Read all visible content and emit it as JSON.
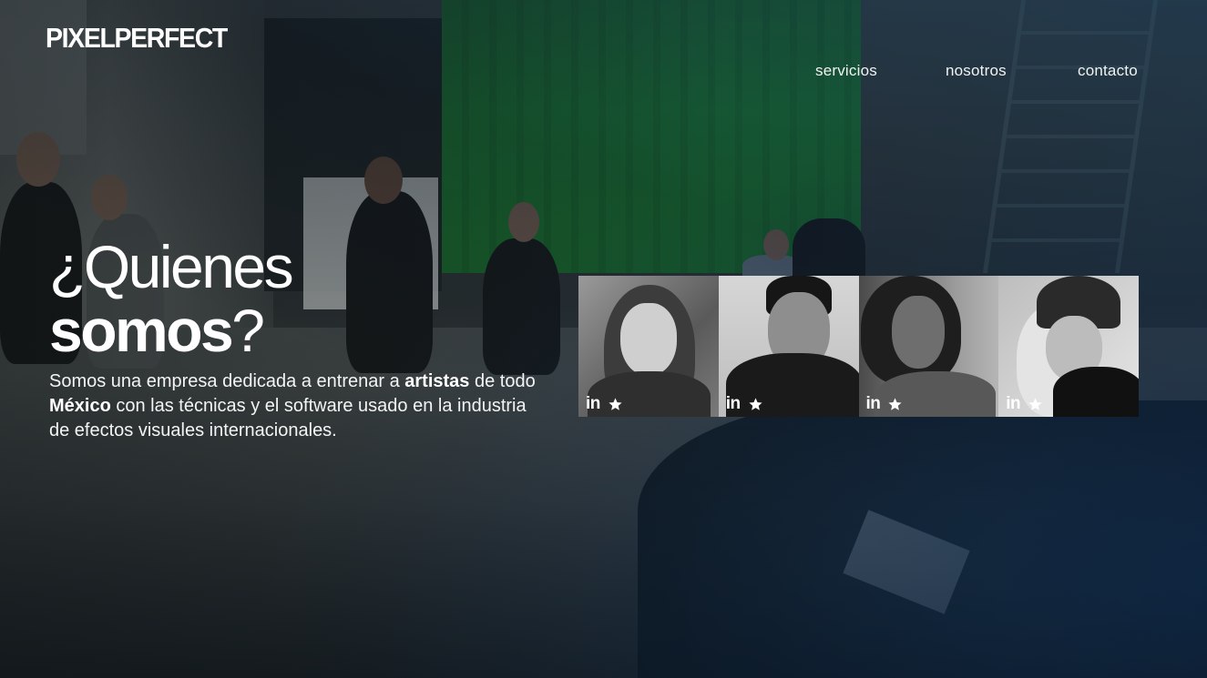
{
  "brand": {
    "logo_text": "PIXELPERFECT"
  },
  "nav": {
    "items": [
      {
        "label": "servicios"
      },
      {
        "label": "nosotros"
      },
      {
        "label": "contacto"
      }
    ]
  },
  "hero": {
    "heading_line1": "¿Quienes",
    "heading_bold": "somos",
    "heading_end": "?",
    "intro": {
      "part1": "Somos una empresa dedicada a entrenar a ",
      "bold1": "artistas",
      "part2": " de todo ",
      "bold2": "México",
      "part3": " con las técnicas y el software usado en la industria de efectos visuales internacionales."
    }
  },
  "team": {
    "members": [
      {
        "linkedin_label": "in",
        "star_icon": "star-icon"
      },
      {
        "linkedin_label": "in",
        "star_icon": "star-icon"
      },
      {
        "linkedin_label": "in",
        "star_icon": "star-icon"
      },
      {
        "linkedin_label": "in",
        "star_icon": "star-icon"
      }
    ]
  },
  "colors": {
    "text": "#ffffff",
    "chroma_green": "#1d7a31",
    "overlay_blue": "#0c3050"
  }
}
